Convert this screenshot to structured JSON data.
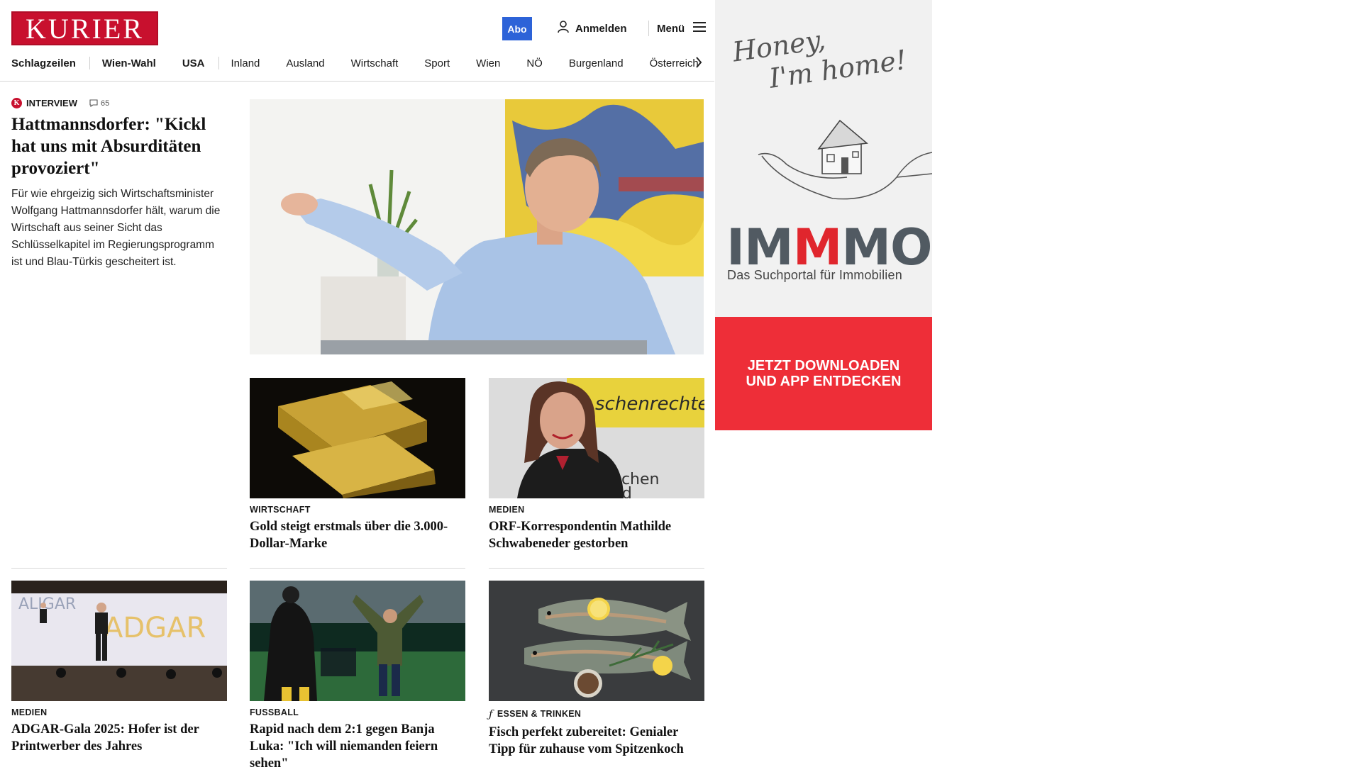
{
  "header": {
    "logo": "KURIER",
    "abo_label": "Abo",
    "login_label": "Anmelden",
    "menu_label": "Menü",
    "nav": [
      {
        "label": "Schlagzeilen",
        "bold": true
      },
      {
        "label": "Wien-Wahl",
        "bold": true
      },
      {
        "label": "USA",
        "bold": true
      },
      {
        "label": "Inland",
        "bold": false
      },
      {
        "label": "Ausland",
        "bold": false
      },
      {
        "label": "Wirtschaft",
        "bold": false
      },
      {
        "label": "Sport",
        "bold": false
      },
      {
        "label": "Wien",
        "bold": false
      },
      {
        "label": "NÖ",
        "bold": false
      },
      {
        "label": "Burgenland",
        "bold": false
      },
      {
        "label": "Österreich",
        "bold": false
      }
    ]
  },
  "lead": {
    "badge": "K",
    "kicker": "INTERVIEW",
    "comments": "65",
    "title": "Hattmannsdorfer: \"Kickl hat uns mit Absurditäten provoziert\"",
    "text": "Für wie ehrgeizig sich Wirtschaftsminister Wolfgang Hattmannsdorfer hält, warum die Wirtschaft aus seiner Sicht das Schlüsselkapitel im Regierungsprogramm ist und Blau-Türkis gescheitert ist."
  },
  "cards": [
    {
      "kicker": "WIRTSCHAFT",
      "title": "Gold steigt erstmals über die 3.000-Dollar-Marke",
      "image": "gold-bars"
    },
    {
      "kicker": "MEDIEN",
      "title": "ORF-Korrespondentin Mathilde Schwabeneder gestorben",
      "image": "portrait-woman"
    },
    {
      "kicker": "MEDIEN",
      "title": "ADGAR-Gala 2025: Hofer ist der Printwerber des Jahres",
      "image": "adgar-stage"
    },
    {
      "kicker": "FUSSBALL",
      "title": "Rapid nach dem 2:1 gegen Banja Luka: \"Ich will niemanden feiern sehen\"",
      "image": "football-coach"
    },
    {
      "kicker": "ESSEN & TRINKEN",
      "title": "Fisch perfekt zubereitet: Genialer Tipp für zuhause vom Spitzenkoch",
      "image": "fish-dish"
    }
  ],
  "ad": {
    "script_line1": "Honey,",
    "script_line2": "I'm home!",
    "brand_a": "IM",
    "brand_b": "M",
    "brand_c": "MO",
    "tagline": "Das Suchportal für Immobilien",
    "cta_line1": "JETZT DOWNLOADEN",
    "cta_line2": "UND APP ENTDECKEN",
    "brand_gray": "#515a62",
    "brand_red": "#e0262d",
    "cta_bg": "#ee2e38"
  },
  "colors": {
    "kurier_red": "#c8102e",
    "abo_blue": "#2d63d8"
  }
}
